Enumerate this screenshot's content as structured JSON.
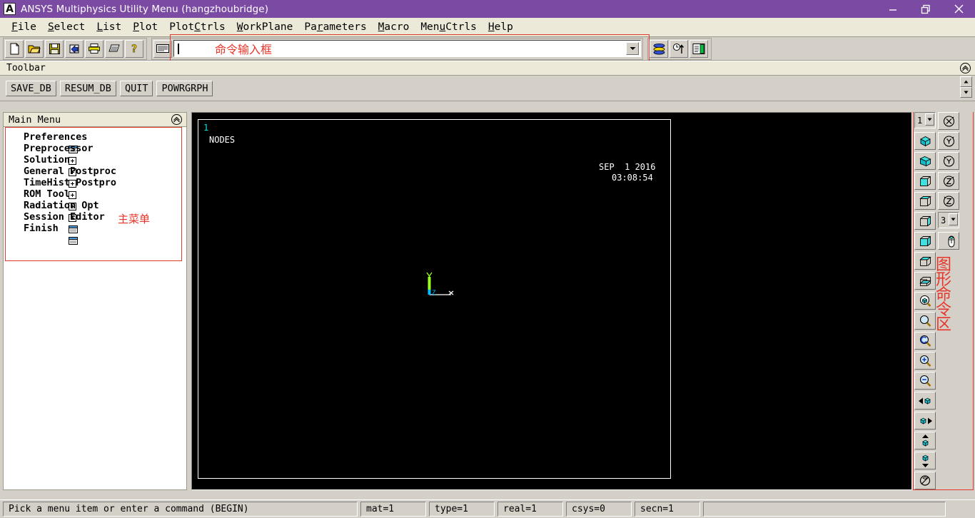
{
  "titlebar": {
    "logo": "A",
    "title": "ANSYS Multiphysics Utility Menu (hangzhoubridge)",
    "minimize": "minimize-icon",
    "restore": "restore-icon",
    "close": "close-icon"
  },
  "menubar": {
    "items": [
      {
        "pre": "",
        "key": "F",
        "post": "ile"
      },
      {
        "pre": "",
        "key": "S",
        "post": "elect"
      },
      {
        "pre": "",
        "key": "L",
        "post": "ist"
      },
      {
        "pre": "",
        "key": "P",
        "post": "lot"
      },
      {
        "pre": "Plot",
        "key": "C",
        "post": "trls"
      },
      {
        "pre": "",
        "key": "W",
        "post": "orkPlane"
      },
      {
        "pre": "Pa",
        "key": "r",
        "post": "ameters"
      },
      {
        "pre": "",
        "key": "M",
        "post": "acro"
      },
      {
        "pre": "Men",
        "key": "u",
        "post": "Ctrls"
      },
      {
        "pre": "",
        "key": "H",
        "post": "elp"
      }
    ]
  },
  "icontoolbar": {
    "left_icons": [
      "new-file-icon",
      "open-folder-icon",
      "save-disk-icon",
      "pan-zoom-rotate-icon",
      "print-icon",
      "report-icon",
      "help-icon"
    ],
    "keyboard_icon": "keyboard-icon",
    "command": {
      "value": "",
      "placeholder": "",
      "annotation": "命令输入框",
      "dropdown_icon": "chevron-down-icon"
    },
    "right_icons": [
      "multiplot-layers-icon",
      "time-history-icon",
      "results-viewer-icon"
    ]
  },
  "toolbar_panel": {
    "header": "Toolbar",
    "collapse_icon": "collapse-up-icon",
    "buttons": [
      "SAVE_DB",
      "RESUM_DB",
      "QUIT",
      "POWRGRPH"
    ],
    "scroll_up_icon": "scroll-up-icon",
    "scroll_down_icon": "scroll-down-icon"
  },
  "main_menu": {
    "header": "Main Menu",
    "collapse_icon": "collapse-up-icon",
    "annotation": "主菜单",
    "items": [
      {
        "label": "Preferences",
        "icon": "window-icon"
      },
      {
        "label": "Preprocessor",
        "icon": "expand-plus-icon"
      },
      {
        "label": "Solution",
        "icon": "expand-plus-icon"
      },
      {
        "label": "General Postproc",
        "icon": "expand-plus-icon"
      },
      {
        "label": "TimeHist Postpro",
        "icon": "expand-plus-icon"
      },
      {
        "label": "ROM Tool",
        "icon": "expand-plus-icon"
      },
      {
        "label": "Radiation Opt",
        "icon": "expand-plus-icon"
      },
      {
        "label": "Session Editor",
        "icon": "window-icon"
      },
      {
        "label": "Finish",
        "icon": "window-icon"
      }
    ]
  },
  "graphics": {
    "window_number": "1",
    "plot_title": "NODES",
    "date": "SEP  1 2016",
    "time": "03:08:54",
    "triad": {
      "x": "X",
      "y": "Y",
      "z": "Z"
    },
    "colors": {
      "background": "#000000",
      "x_axis": "#ffffff",
      "y_axis": "#9aff1e",
      "z_axis": "#00bfff",
      "window_number": "#00e5e5"
    }
  },
  "graphics_rail": {
    "annotation": "图形命令区",
    "window_select": {
      "value": "1",
      "dropdown_icon": "chevron-down-icon"
    },
    "speed_select": {
      "value": "3",
      "dropdown_icon": "chevron-down-icon"
    },
    "left_icons": [
      "iso-view-icon",
      "oblique-view-icon",
      "front-view-icon",
      "top-view-icon",
      "left-view-icon",
      "right-view-icon",
      "back-view-icon",
      "bottom-view-icon",
      "zoom-box-icon",
      "zoom-window-icon",
      "zoom-back-icon",
      "zoom-in-icon",
      "zoom-out-icon",
      "pan-left-icon",
      "pan-right-icon",
      "pan-up-icon",
      "pan-down-icon",
      "fit-view-icon"
    ],
    "right_icons": [
      "rotate-x-icon",
      "rotate-y-plus-icon",
      "rotate-y-minus-icon",
      "rotate-z-plus-icon",
      "rotate-z-minus-icon",
      "dynamic-mode-icon"
    ]
  },
  "statusbar": {
    "message": "Pick a menu item or enter a command (BEGIN)",
    "fields": [
      "mat=1",
      "type=1",
      "real=1",
      "csys=0",
      "secn=1"
    ],
    "extra": ""
  },
  "colors": {
    "title_purple": "#7b4ba3",
    "annotation_red": "#e8352a",
    "face": "#d4d0c8",
    "menu_face": "#ece9d8"
  }
}
